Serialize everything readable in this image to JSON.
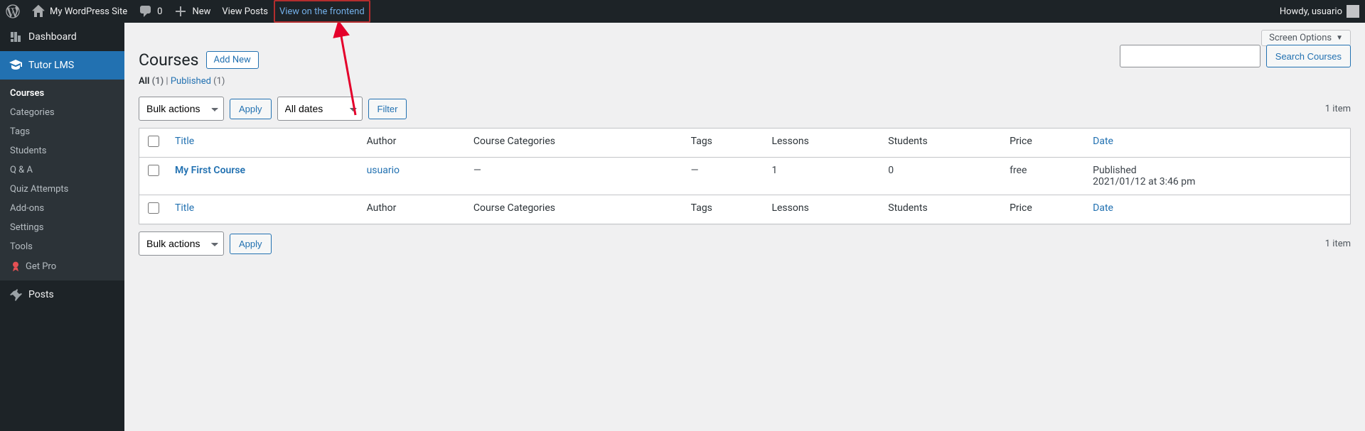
{
  "adminbar": {
    "site_name": "My WordPress Site",
    "comments_count": "0",
    "new_label": "New",
    "view_posts": "View Posts",
    "view_frontend": "View on the frontend",
    "howdy_prefix": "Howdy, ",
    "username": "usuario"
  },
  "menu": {
    "dashboard": "Dashboard",
    "tutor_lms": "Tutor LMS",
    "posts": "Posts",
    "tutor_submenu": {
      "courses": "Courses",
      "categories": "Categories",
      "tags": "Tags",
      "students": "Students",
      "qa": "Q & A",
      "quiz_attempts": "Quiz Attempts",
      "addons": "Add-ons",
      "settings": "Settings",
      "tools": "Tools",
      "get_pro": "Get Pro"
    }
  },
  "screen_options": "Screen Options",
  "heading": "Courses",
  "add_new": "Add New",
  "filters": {
    "all_label": "All",
    "all_count": "(1)",
    "sep": " | ",
    "published_label": "Published",
    "published_count": "(1)"
  },
  "bulk_actions": "Bulk actions",
  "apply": "Apply",
  "all_dates": "All dates",
  "filter": "Filter",
  "item_count": "1 item",
  "search": {
    "button": "Search Courses",
    "placeholder": ""
  },
  "columns": {
    "title": "Title",
    "author": "Author",
    "course_categories": "Course Categories",
    "tags": "Tags",
    "lessons": "Lessons",
    "students": "Students",
    "price": "Price",
    "date": "Date"
  },
  "rows": [
    {
      "title": "My First Course",
      "author": "usuario",
      "course_categories": "—",
      "tags": "—",
      "lessons": "1",
      "students": "0",
      "price": "free",
      "date_status": "Published",
      "date_value": "2021/01/12 at 3:46 pm"
    }
  ]
}
